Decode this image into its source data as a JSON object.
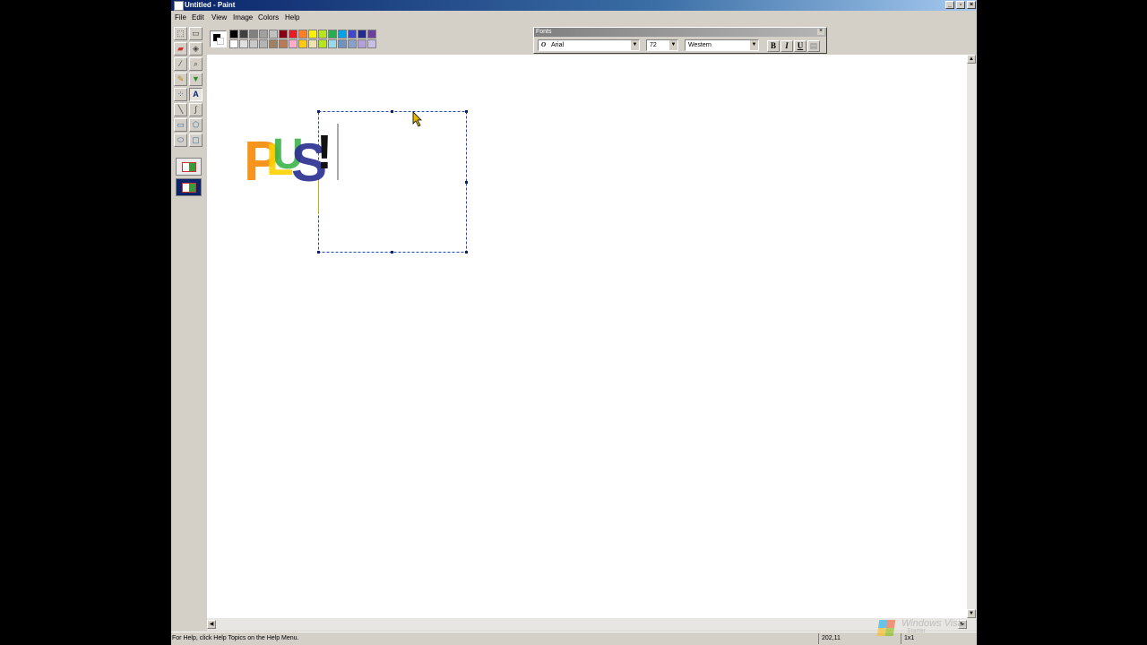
{
  "window": {
    "title": "Untitled - Paint"
  },
  "menu": [
    "File",
    "Edit",
    "View",
    "Image",
    "Colors",
    "Help"
  ],
  "toolbox": {
    "tools": [
      "free-form-select",
      "select",
      "eraser",
      "fill-with-color",
      "pick-color",
      "magnifier",
      "pencil",
      "brush",
      "airbrush",
      "text",
      "line",
      "curve",
      "rectangle",
      "polygon",
      "ellipse",
      "rounded-rectangle"
    ],
    "active_tool": "text",
    "options": [
      "opaque-background",
      "transparent-background"
    ],
    "selected_option": "transparent-background"
  },
  "palette": {
    "foreground": "#000000",
    "background": "#ffffff",
    "colors": [
      "#000000",
      "#404040",
      "#808080",
      "#a0a0a0",
      "#c0c0c0",
      "#880015",
      "#ed1c24",
      "#ff7f27",
      "#fff200",
      "#b5e61d",
      "#22b14c",
      "#00a2e8",
      "#3f48cc",
      "#222a8f",
      "#6a3fa0",
      "#ffffff",
      "#e0e0e0",
      "#c8c8c8",
      "#b4b4b4",
      "#a08060",
      "#b97a57",
      "#ffaec9",
      "#ffc90e",
      "#efe4b0",
      "#b5e61d",
      "#99d9ea",
      "#7092be",
      "#8aa0c8",
      "#b4a0d8",
      "#c8bfe7"
    ]
  },
  "fonts_toolbar": {
    "title": "Fonts",
    "font_name": "Arial",
    "font_size": "72",
    "script": "Western",
    "bold_label": "B",
    "italic_label": "I",
    "underline_label": "U"
  },
  "canvas": {
    "logo_letters": [
      "P",
      "L",
      "U",
      "S",
      "!"
    ],
    "logo_colors": [
      "#f7941d",
      "#ffd200",
      "#3cb44b",
      "#2e3192",
      "#111111"
    ]
  },
  "status": {
    "help": "For Help, click Help Topics on the Help Menu.",
    "coordinates": "202,11",
    "size": "1x1"
  },
  "watermark": {
    "text": "Windows Vista",
    "sub": "Starter"
  }
}
